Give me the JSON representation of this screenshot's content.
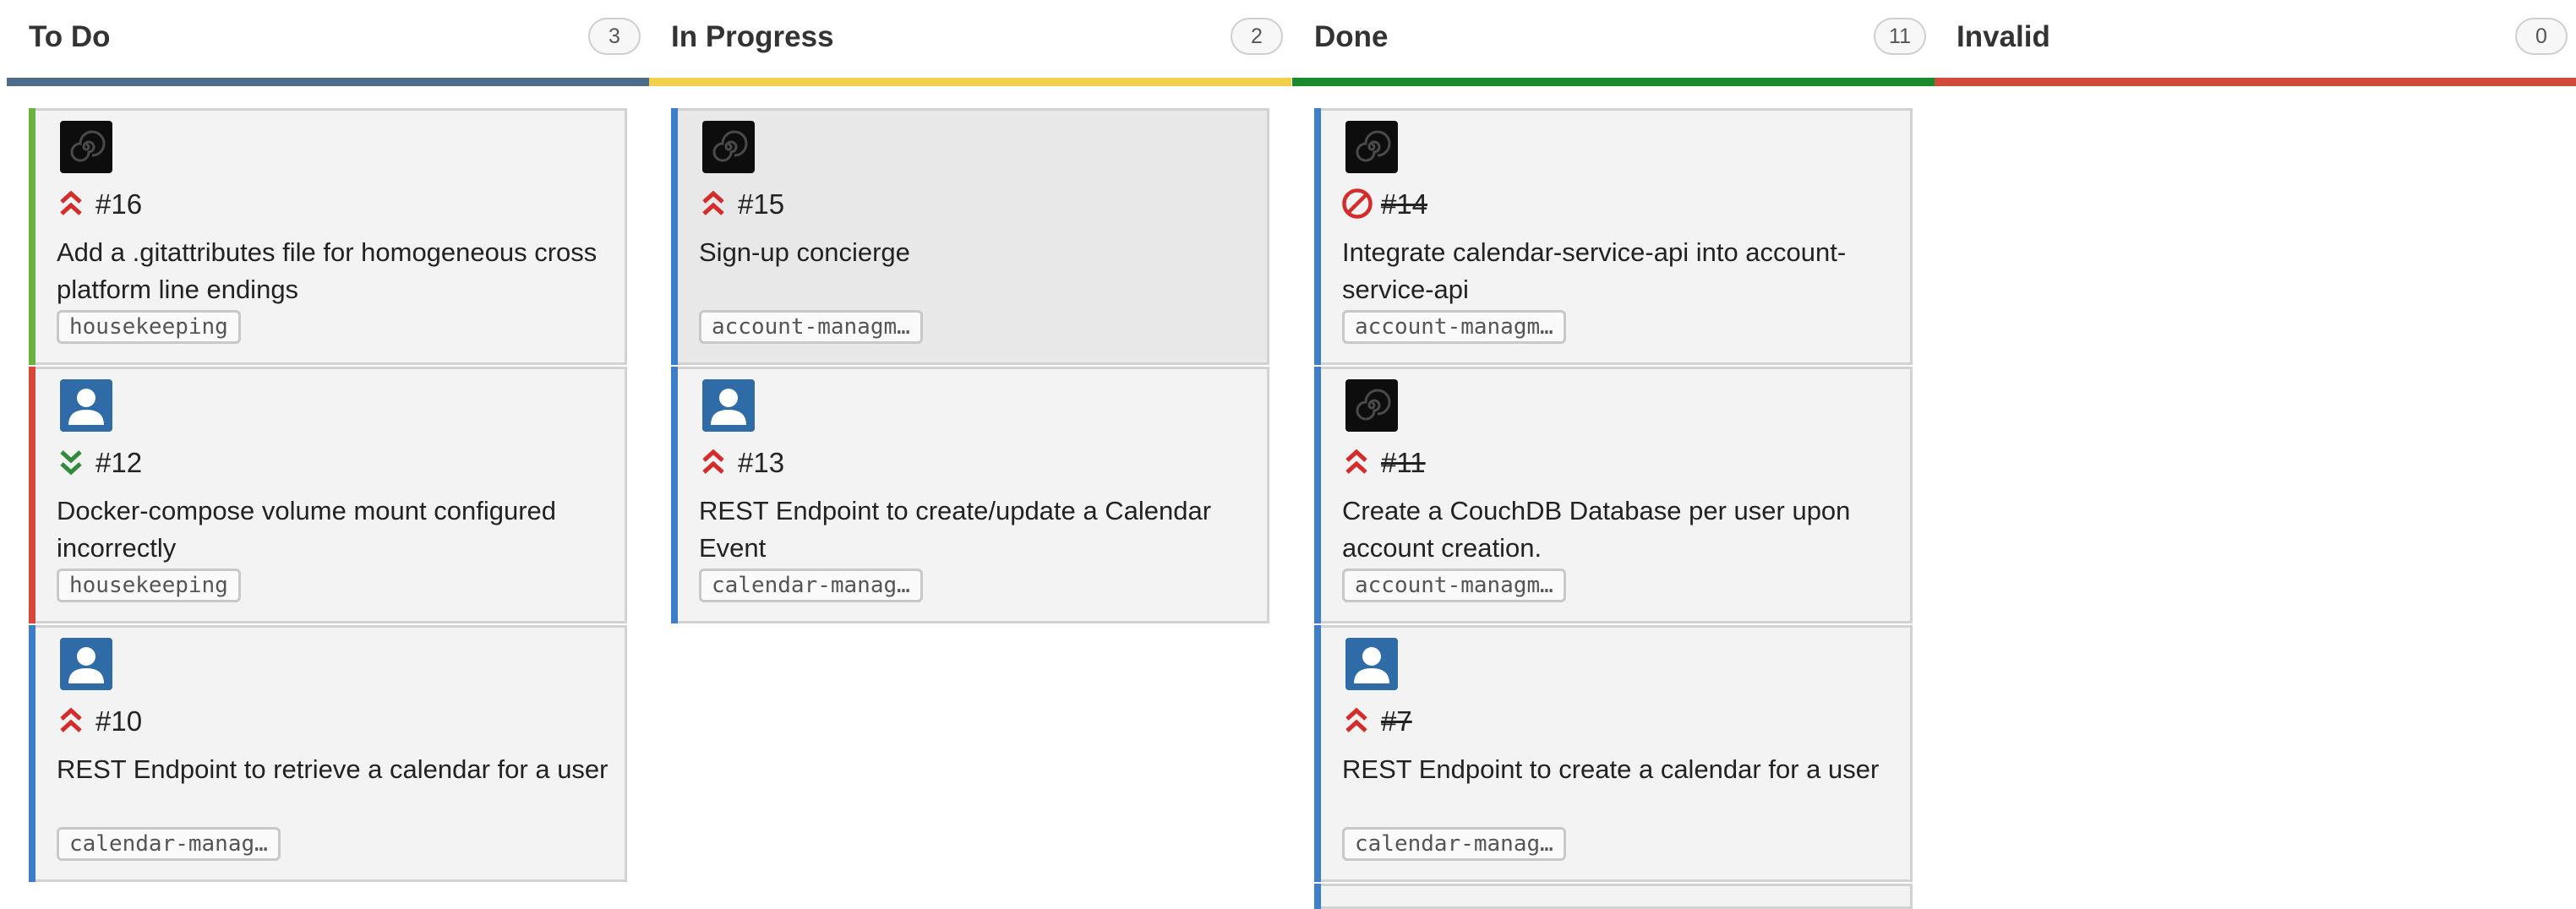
{
  "colors": {
    "todo_bar": "#4e6b8c",
    "inprogress_bar": "#f2d04b",
    "done_bar": "#1a8a2e",
    "invalid_bar": "#d24a3c",
    "stripe_green": "#6db33f",
    "stripe_red": "#d9463a",
    "stripe_blue": "#3d7dca",
    "priority_high": "#d52b2b",
    "priority_low": "#2f8a3a"
  },
  "columns": [
    {
      "title": "To Do",
      "count": "3",
      "cards": [
        {
          "number": "#16",
          "title": "Add a .gitattributes file for homogeneous cross platform line endings",
          "tag": "housekeeping",
          "avatar": "spiral-avatar",
          "priority": "high-icon",
          "closed": false
        },
        {
          "number": "#12",
          "title": "Docker-compose volume mount configured incorrectly",
          "tag": "housekeeping",
          "avatar": "user-avatar",
          "priority": "low-icon",
          "closed": false
        },
        {
          "number": "#10",
          "title": "REST Endpoint to retrieve a calendar for a user",
          "tag": "calendar-manag…",
          "avatar": "user-avatar",
          "priority": "high-icon",
          "closed": false
        }
      ]
    },
    {
      "title": "In Progress",
      "count": "2",
      "cards": [
        {
          "number": "#15",
          "title": "Sign-up concierge",
          "tag": "account-managm…",
          "avatar": "spiral-avatar",
          "priority": "high-icon",
          "closed": false
        },
        {
          "number": "#13",
          "title": "REST Endpoint to create/update a Calendar Event",
          "tag": "calendar-manag…",
          "avatar": "user-avatar",
          "priority": "high-icon",
          "closed": false
        }
      ]
    },
    {
      "title": "Done",
      "count": "11",
      "cards": [
        {
          "number": "#14",
          "title": "Integrate calendar-service-api into account-service-api",
          "tag": "account-managm…",
          "avatar": "spiral-avatar",
          "priority": "blocked-icon",
          "closed": true
        },
        {
          "number": "#11",
          "title": "Create a CouchDB Database per user upon account creation.",
          "tag": "account-managm…",
          "avatar": "spiral-avatar",
          "priority": "high-icon",
          "closed": true
        },
        {
          "number": "#7",
          "title": "REST Endpoint to create a calendar for a user",
          "tag": "calendar-manag…",
          "avatar": "user-avatar",
          "priority": "high-icon",
          "closed": true
        }
      ]
    },
    {
      "title": "Invalid",
      "count": "0",
      "cards": []
    }
  ]
}
